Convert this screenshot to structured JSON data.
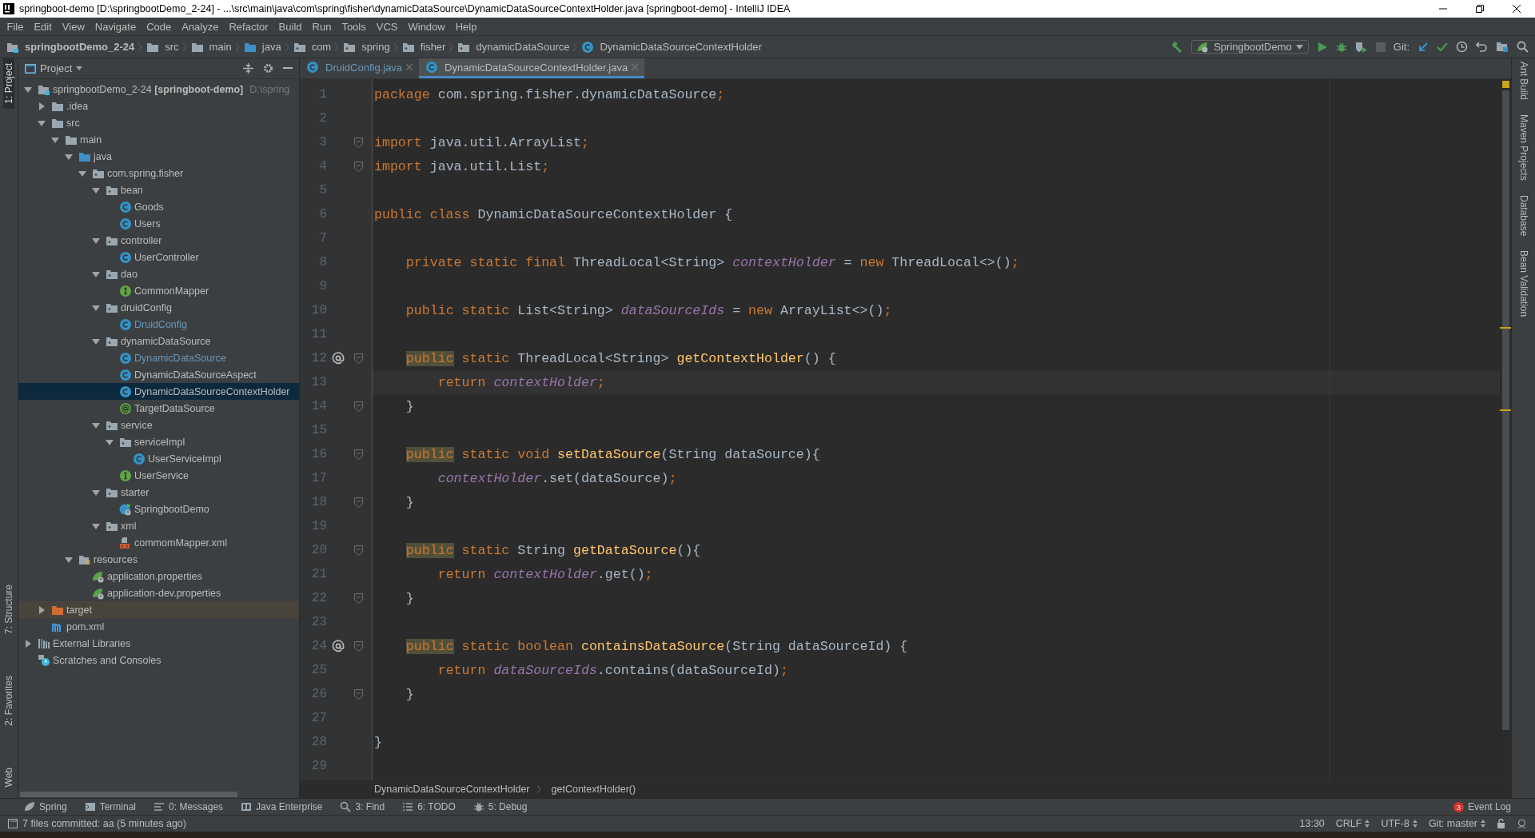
{
  "window": {
    "title": "springboot-demo [D:\\springbootDemo_2-24] - ...\\src\\main\\java\\com\\spring\\fisher\\dynamicDataSource\\DynamicDataSourceContextHolder.java [springboot-demo] - IntelliJ IDEA"
  },
  "menu": [
    "File",
    "Edit",
    "View",
    "Navigate",
    "Code",
    "Analyze",
    "Refactor",
    "Build",
    "Run",
    "Tools",
    "VCS",
    "Window",
    "Help"
  ],
  "navigation": [
    {
      "label": "springbootDemo_2-24",
      "kind": "module"
    },
    {
      "label": "src",
      "kind": "folder"
    },
    {
      "label": "main",
      "kind": "folder"
    },
    {
      "label": "java",
      "kind": "source-folder"
    },
    {
      "label": "com",
      "kind": "package"
    },
    {
      "label": "spring",
      "kind": "package"
    },
    {
      "label": "fisher",
      "kind": "package"
    },
    {
      "label": "dynamicDataSource",
      "kind": "package"
    },
    {
      "label": "DynamicDataSourceContextHolder",
      "kind": "class"
    }
  ],
  "toolbar": {
    "run_configuration": "SpringbootDemo",
    "git_label": "Git:"
  },
  "left_stripe": [
    {
      "label": "1: Project",
      "selected": true
    },
    {
      "label": "7: Structure",
      "selected": false
    },
    {
      "label": "2: Favorites",
      "selected": false
    },
    {
      "label": "Web",
      "selected": false
    }
  ],
  "right_stripe": [
    "Ant Build",
    "Maven Projects",
    "Database",
    "Bean Validation"
  ],
  "project_panel": {
    "title": "Project",
    "tree": [
      {
        "label": "springbootDemo_2-24 **[springboot-demo]**",
        "path": "D:\\spring",
        "kind": "module",
        "expanded": true,
        "selected": false,
        "modified": false,
        "children": [
          {
            "label": ".idea",
            "kind": "folder",
            "expanded": false,
            "selected": false,
            "modified": false
          },
          {
            "label": "src",
            "kind": "folder",
            "expanded": true,
            "selected": false,
            "modified": false,
            "children": [
              {
                "label": "main",
                "kind": "folder",
                "expanded": true,
                "selected": false,
                "modified": false,
                "children": [
                  {
                    "label": "java",
                    "kind": "source-folder",
                    "expanded": true,
                    "selected": false,
                    "modified": false,
                    "children": [
                      {
                        "label": "com.spring.fisher",
                        "kind": "package",
                        "expanded": true,
                        "selected": false,
                        "modified": false,
                        "children": [
                          {
                            "label": "bean",
                            "kind": "package",
                            "expanded": true,
                            "selected": false,
                            "modified": false,
                            "children": [
                              {
                                "label": "Goods",
                                "kind": "class",
                                "selected": false,
                                "modified": false
                              },
                              {
                                "label": "Users",
                                "kind": "class",
                                "selected": false,
                                "modified": false
                              }
                            ]
                          },
                          {
                            "label": "controller",
                            "kind": "package",
                            "expanded": true,
                            "selected": false,
                            "modified": false,
                            "children": [
                              {
                                "label": "UserController",
                                "kind": "class",
                                "selected": false,
                                "modified": false
                              }
                            ]
                          },
                          {
                            "label": "dao",
                            "kind": "package",
                            "expanded": true,
                            "selected": false,
                            "modified": false,
                            "children": [
                              {
                                "label": "CommonMapper",
                                "kind": "interface",
                                "selected": false,
                                "modified": false
                              }
                            ]
                          },
                          {
                            "label": "druidConfig",
                            "kind": "package",
                            "expanded": true,
                            "selected": false,
                            "modified": false,
                            "children": [
                              {
                                "label": "DruidConfig",
                                "kind": "class",
                                "selected": false,
                                "modified": true
                              }
                            ]
                          },
                          {
                            "label": "dynamicDataSource",
                            "kind": "package",
                            "expanded": true,
                            "selected": false,
                            "modified": false,
                            "children": [
                              {
                                "label": "DynamicDataSource",
                                "kind": "class",
                                "selected": false,
                                "modified": true
                              },
                              {
                                "label": "DynamicDataSourceAspect",
                                "kind": "class",
                                "selected": false,
                                "modified": false
                              },
                              {
                                "label": "DynamicDataSourceContextHolder",
                                "kind": "class",
                                "selected": true,
                                "modified": false
                              },
                              {
                                "label": "TargetDataSource",
                                "kind": "annotation",
                                "selected": false,
                                "modified": false
                              }
                            ]
                          },
                          {
                            "label": "service",
                            "kind": "package",
                            "expanded": true,
                            "selected": false,
                            "modified": false,
                            "children": [
                              {
                                "label": "serviceImpl",
                                "kind": "package",
                                "expanded": true,
                                "selected": false,
                                "modified": false,
                                "children": [
                                  {
                                    "label": "UserServiceImpl",
                                    "kind": "class",
                                    "selected": false,
                                    "modified": false
                                  }
                                ]
                              },
                              {
                                "label": "UserService",
                                "kind": "interface",
                                "selected": false,
                                "modified": false
                              }
                            ]
                          },
                          {
                            "label": "starter",
                            "kind": "package",
                            "expanded": true,
                            "selected": false,
                            "modified": false,
                            "children": [
                              {
                                "label": "SpringbootDemo",
                                "kind": "boot-class",
                                "selected": false,
                                "modified": false
                              }
                            ]
                          },
                          {
                            "label": "xml",
                            "kind": "package",
                            "expanded": true,
                            "selected": false,
                            "modified": false,
                            "children": [
                              {
                                "label": "commomMapper.xml",
                                "kind": "xml",
                                "selected": false,
                                "modified": false
                              }
                            ]
                          }
                        ]
                      }
                    ]
                  },
                  {
                    "label": "resources",
                    "kind": "resources",
                    "expanded": true,
                    "selected": false,
                    "modified": false,
                    "children": [
                      {
                        "label": "application.properties",
                        "kind": "properties",
                        "selected": false,
                        "modified": false
                      },
                      {
                        "label": "application-dev.properties",
                        "kind": "properties",
                        "selected": false,
                        "modified": false
                      }
                    ]
                  }
                ]
              }
            ]
          },
          {
            "label": "target",
            "kind": "excluded-folder",
            "expanded": false,
            "selected": false,
            "modified": false
          },
          {
            "label": "pom.xml",
            "kind": "maven",
            "selected": false,
            "modified": false
          }
        ]
      },
      {
        "label": "External Libraries",
        "kind": "libraries",
        "expanded": false,
        "selected": false,
        "modified": false
      },
      {
        "label": "Scratches and Consoles",
        "kind": "scratches",
        "selected": false,
        "modified": false
      }
    ]
  },
  "editor": {
    "tabs": [
      {
        "label": "DruidConfig.java",
        "selected": false,
        "modified": true
      },
      {
        "label": "DynamicDataSourceContextHolder.java",
        "selected": true,
        "modified": false
      }
    ],
    "lines": [
      {
        "number": "1",
        "tokens": [
          {
            "text": "package",
            "kind": "keyword"
          },
          {
            "text": " com.spring.fisher.dynamicDataSource",
            "kind": "plain"
          },
          {
            "text": ";",
            "kind": "keyword"
          }
        ]
      },
      {
        "number": "2"
      },
      {
        "number": "3",
        "fold": true,
        "tokens": [
          {
            "text": "import",
            "kind": "keyword"
          },
          {
            "text": " java.util.ArrayList",
            "kind": "plain"
          },
          {
            "text": ";",
            "kind": "keyword"
          }
        ]
      },
      {
        "number": "4",
        "fold": true,
        "tokens": [
          {
            "text": "import",
            "kind": "keyword"
          },
          {
            "text": " java.util.List",
            "kind": "plain"
          },
          {
            "text": ";",
            "kind": "keyword"
          }
        ]
      },
      {
        "number": "5"
      },
      {
        "number": "6",
        "tokens": [
          {
            "text": "public class",
            "kind": "keyword"
          },
          {
            "text": " DynamicDataSourceContextHolder {",
            "kind": "plain"
          }
        ]
      },
      {
        "number": "7"
      },
      {
        "number": "8",
        "tokens": [
          {
            "text": "    private static final",
            "kind": "keyword"
          },
          {
            "text": " ThreadLocal<String> ",
            "kind": "plain"
          },
          {
            "text": "contextHolder",
            "kind": "field"
          },
          {
            "text": " = ",
            "kind": "plain"
          },
          {
            "text": "new",
            "kind": "keyword"
          },
          {
            "text": " ThreadLocal<>()",
            "kind": "plain"
          },
          {
            "text": ";",
            "kind": "keyword"
          }
        ]
      },
      {
        "number": "9"
      },
      {
        "number": "10",
        "tokens": [
          {
            "text": "    public static",
            "kind": "keyword"
          },
          {
            "text": " List<String> ",
            "kind": "plain"
          },
          {
            "text": "dataSourceIds",
            "kind": "field"
          },
          {
            "text": " = ",
            "kind": "plain"
          },
          {
            "text": "new",
            "kind": "keyword"
          },
          {
            "text": " ArrayList<>()",
            "kind": "plain"
          },
          {
            "text": ";",
            "kind": "keyword"
          }
        ]
      },
      {
        "number": "11"
      },
      {
        "number": "12",
        "fold": true,
        "gutter_mark": true,
        "tokens": [
          {
            "text": "    public",
            "kind": "highlight"
          },
          {
            "text": " static",
            "kind": "keyword"
          },
          {
            "text": " ThreadLocal<String> ",
            "kind": "plain"
          },
          {
            "text": "getContextHolder",
            "kind": "method"
          },
          {
            "text": "() {",
            "kind": "plain"
          }
        ]
      },
      {
        "number": "13",
        "current": true,
        "tokens": [
          {
            "text": "        return ",
            "kind": "keyword"
          },
          {
            "text": "contextHolder",
            "kind": "field"
          },
          {
            "text": ";",
            "kind": "keyword"
          }
        ]
      },
      {
        "number": "14",
        "fold": true,
        "tokens": [
          {
            "text": "    }",
            "kind": "plain"
          }
        ]
      },
      {
        "number": "15"
      },
      {
        "number": "16",
        "fold": true,
        "tokens": [
          {
            "text": "    public",
            "kind": "highlight"
          },
          {
            "text": " static void ",
            "kind": "keyword"
          },
          {
            "text": "setDataSource",
            "kind": "method"
          },
          {
            "text": "(String dataSource){",
            "kind": "plain"
          }
        ]
      },
      {
        "number": "17",
        "tokens": [
          {
            "text": "        contextHolder",
            "kind": "field"
          },
          {
            "text": ".set(dataSource)",
            "kind": "plain"
          },
          {
            "text": ";",
            "kind": "keyword"
          }
        ]
      },
      {
        "number": "18",
        "fold": true,
        "tokens": [
          {
            "text": "    }",
            "kind": "plain"
          }
        ]
      },
      {
        "number": "19"
      },
      {
        "number": "20",
        "fold": true,
        "tokens": [
          {
            "text": "    public",
            "kind": "highlight"
          },
          {
            "text": " static",
            "kind": "keyword"
          },
          {
            "text": " String ",
            "kind": "plain"
          },
          {
            "text": "getDataSource",
            "kind": "method"
          },
          {
            "text": "(){",
            "kind": "plain"
          }
        ]
      },
      {
        "number": "21",
        "tokens": [
          {
            "text": "        return ",
            "kind": "keyword"
          },
          {
            "text": "contextHolder",
            "kind": "field"
          },
          {
            "text": ".get()",
            "kind": "plain"
          },
          {
            "text": ";",
            "kind": "keyword"
          }
        ]
      },
      {
        "number": "22",
        "fold": true,
        "tokens": [
          {
            "text": "    }",
            "kind": "plain"
          }
        ]
      },
      {
        "number": "23"
      },
      {
        "number": "24",
        "fold": true,
        "gutter_mark": true,
        "tokens": [
          {
            "text": "    public",
            "kind": "highlight"
          },
          {
            "text": " static boolean ",
            "kind": "keyword"
          },
          {
            "text": "containsDataSource",
            "kind": "method"
          },
          {
            "text": "(String dataSourceId) {",
            "kind": "plain"
          }
        ]
      },
      {
        "number": "25",
        "tokens": [
          {
            "text": "        return ",
            "kind": "keyword"
          },
          {
            "text": "dataSourceIds",
            "kind": "field"
          },
          {
            "text": ".contains(dataSourceId)",
            "kind": "plain"
          },
          {
            "text": ";",
            "kind": "keyword"
          }
        ]
      },
      {
        "number": "26",
        "fold": true,
        "tokens": [
          {
            "text": "    }",
            "kind": "plain"
          }
        ]
      },
      {
        "number": "27"
      },
      {
        "number": "28",
        "tokens": [
          {
            "text": "}",
            "kind": "plain"
          }
        ]
      },
      {
        "number": "29"
      }
    ],
    "breadcrumbs": [
      "DynamicDataSourceContextHolder",
      "getContextHolder()"
    ]
  },
  "tool_buttons": [
    {
      "label": "Spring",
      "kind": "spring"
    },
    {
      "label": "Terminal",
      "kind": "terminal"
    },
    {
      "label": "0: Messages",
      "kind": "messages"
    },
    {
      "label": "Java Enterprise",
      "kind": "enterprise"
    },
    {
      "label": "3: Find",
      "kind": "find"
    },
    {
      "label": "6: TODO",
      "kind": "todo"
    },
    {
      "label": "5: Debug",
      "kind": "debug"
    }
  ],
  "event_log": {
    "label": "Event Log",
    "count": "3"
  },
  "status_bar": {
    "message": "7 files committed: aa (5 minutes ago)",
    "position": "13:30",
    "line_separator": "CRLF",
    "encoding": "UTF-8",
    "branch": "Git: master"
  }
}
